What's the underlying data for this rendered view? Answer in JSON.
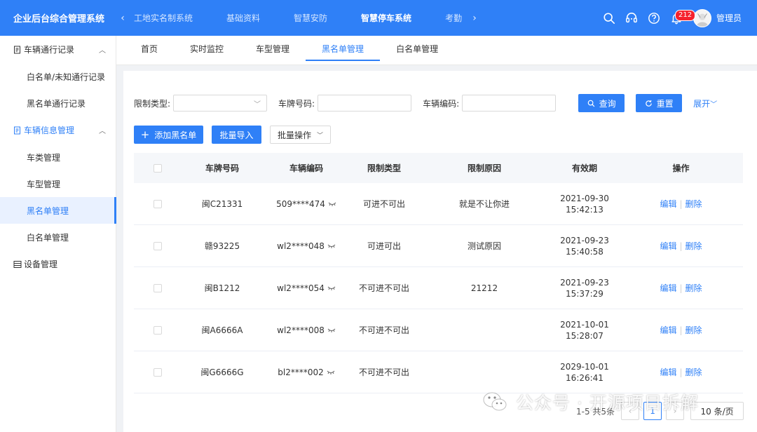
{
  "app": {
    "title": "企业后台综合管理系统"
  },
  "topnav": {
    "items": [
      "工地实名制系统",
      "基础资料",
      "智慧安防",
      "智慧停车系统",
      "考勤"
    ],
    "prev_icon": "chevron-left-icon",
    "next_icon": "chevron-right-icon"
  },
  "header_right": {
    "icons": [
      "search-icon",
      "headset-icon",
      "help-icon",
      "bell-icon"
    ],
    "notification_count": "212",
    "username": "管理员"
  },
  "sidebar": {
    "groups": [
      {
        "label": "车辆通行记录",
        "icon": "record-icon",
        "items": [
          "白名单/未知通行记录",
          "黑名单通行记录"
        ]
      },
      {
        "label": "车辆信息管理",
        "icon": "vehicle-info-icon",
        "items": [
          "车类管理",
          "车型管理",
          "黑名单管理",
          "白名单管理"
        ]
      },
      {
        "label": "设备管理",
        "icon": "device-icon",
        "items": []
      }
    ],
    "active_item": "黑名单管理"
  },
  "tabs": [
    "首页",
    "实时监控",
    "车型管理",
    "黑名单管理",
    "白名单管理"
  ],
  "filters": {
    "restriction_type_label": "限制类型:",
    "plate_label": "车牌号码:",
    "code_label": "车辆编码:",
    "query_button": "查询",
    "reset_button": "重置",
    "expand_link": "展开"
  },
  "actions": {
    "add_button": "添加黑名单",
    "import_button": "批量导入",
    "batch_button": "批量操作"
  },
  "table": {
    "columns": [
      "车牌号码",
      "车辆编码",
      "限制类型",
      "限制原因",
      "有效期",
      "操作"
    ],
    "rows": [
      {
        "plate": "闽C21331",
        "code": "509****474",
        "type": "可进不可出",
        "reason": "就是不让你进",
        "date": "2021-09-30",
        "time": "15:42:13"
      },
      {
        "plate": "赣93225",
        "code": "wl2****048",
        "type": "可进可出",
        "reason": "测试原因",
        "date": "2021-09-23",
        "time": "15:40:58"
      },
      {
        "plate": "闽B1212",
        "code": "wl2****054",
        "type": "不可进不可出",
        "reason": "21212",
        "date": "2021-09-23",
        "time": "15:37:29"
      },
      {
        "plate": "闽A6666A",
        "code": "wl2****008",
        "type": "不可进不可出",
        "reason": "",
        "date": "2021-10-01",
        "time": "15:28:07"
      },
      {
        "plate": "闽G6666G",
        "code": "bl2****002",
        "type": "不可进不可出",
        "reason": "",
        "date": "2029-10-01",
        "time": "16:26:41"
      }
    ],
    "edit_label": "编辑",
    "delete_label": "删除"
  },
  "pagination": {
    "total_text": "1-5 共5条",
    "current_page": "1",
    "page_size": "10 条/页"
  },
  "watermark": {
    "text": "公众号 · 开源项目拆解"
  },
  "colors": {
    "primary": "#2f80f7",
    "header": "#2f80f7",
    "badge": "#f5222d"
  }
}
